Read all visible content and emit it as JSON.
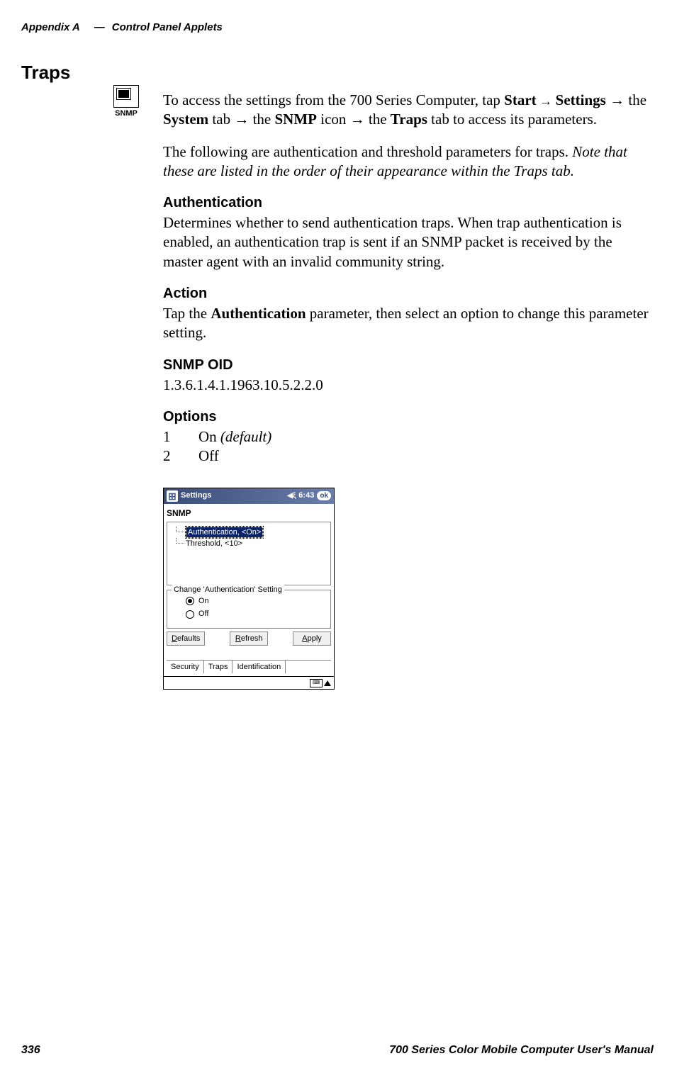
{
  "header": {
    "appendix": "Appendix  A",
    "dash": "—",
    "title": "Control Panel Applets"
  },
  "section": {
    "title": "Traps"
  },
  "iconLabel": "SNMP",
  "intro": {
    "pre": "To access the settings from the 700 Series Computer, tap ",
    "b1": "Start",
    "arrow": " → ",
    "b2": "Settings",
    "mid1": " → the ",
    "b3": "System",
    "mid2": " tab → the ",
    "b4": "SNMP",
    "mid3": " icon → the ",
    "b5": "Traps",
    "post": " tab to access its parameters."
  },
  "para2": {
    "pre": "The following are authentication and threshold parameters for traps. ",
    "ital": "Note that these are listed in the order of their appearance within the Traps tab."
  },
  "auth": {
    "heading": "Authentication",
    "body": "Determines whether to send authentication traps. When trap authentication is enabled, an authentication trap is sent if an SNMP packet is received by the master agent with an invalid community string."
  },
  "action": {
    "heading": "Action",
    "pre": "Tap the ",
    "bold": "Authentication",
    "post": " parameter, then select an option to change this parameter setting."
  },
  "oid": {
    "heading": "SNMP OID",
    "value": "1.3.6.1.4.1.1963.10.5.2.2.0"
  },
  "options": {
    "heading": "Options",
    "rows": [
      {
        "num": "1",
        "label": "On ",
        "ital": "(default)"
      },
      {
        "num": "2",
        "label": "Off",
        "ital": ""
      }
    ]
  },
  "screenshot": {
    "titlebar": {
      "title": "Settings",
      "time": "6:43",
      "ok": "ok"
    },
    "appTitle": "SNMP",
    "tree": {
      "item1": "Authentication, <On>",
      "item2": "Threshold, <10>"
    },
    "group": {
      "legend": "Change 'Authentication' Setting",
      "on": "On",
      "off": "Off"
    },
    "buttons": {
      "defaults": "efaults",
      "defaults_u": "D",
      "refresh": "efresh",
      "refresh_u": "R",
      "apply": "pply",
      "apply_u": "A"
    },
    "tabs": {
      "security": "Security",
      "traps": "Traps",
      "identification": "Identification"
    }
  },
  "footer": {
    "page": "336",
    "title": "700 Series Color Mobile Computer User's Manual"
  }
}
